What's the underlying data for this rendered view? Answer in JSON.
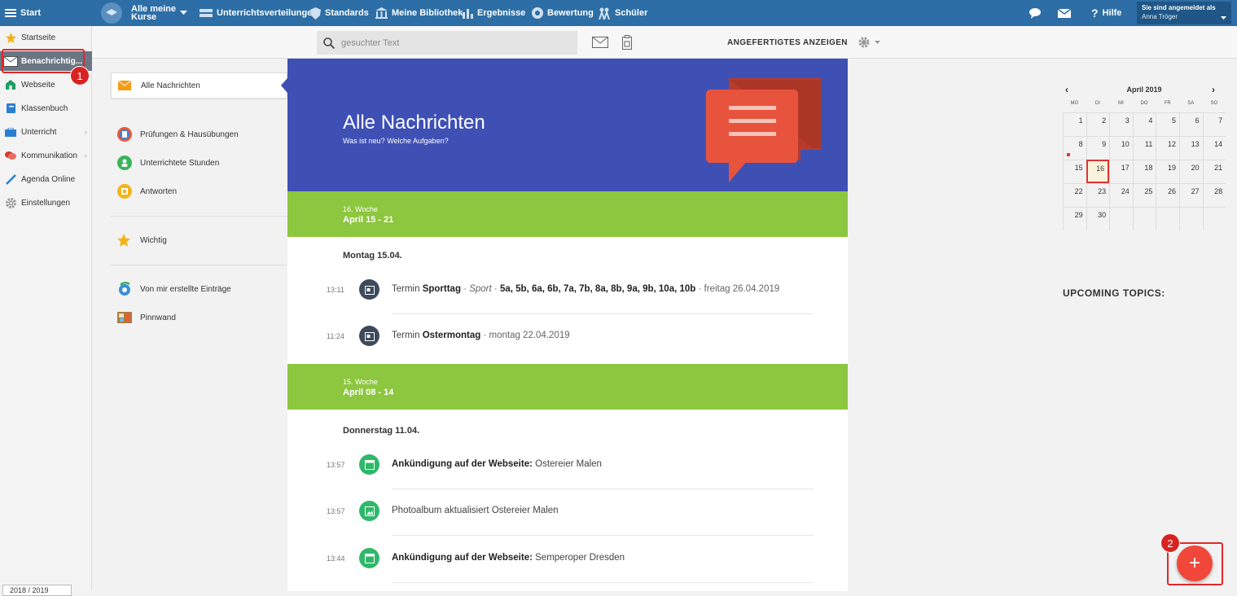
{
  "topbar": {
    "menu_label": "Start",
    "courses_label_1": "Alle meine",
    "courses_label_2": "Kurse",
    "nav": [
      "Unterrichtsverteilungen",
      "Standards",
      "Meine Bibliothek",
      "Ergebnisse",
      "Bewertung",
      "Schüler"
    ],
    "help_label": "Hilfe",
    "logged_in_label": "Sie sind angemeldet als",
    "user_name": "Anna Tröger"
  },
  "sidebar": {
    "items": [
      "Startseite",
      "Benachrichtig...",
      "Webseite",
      "Klassenbuch",
      "Unterricht",
      "Kommunikation",
      "Agenda Online",
      "Einstellungen"
    ],
    "year": "2018 / 2019"
  },
  "toolbar": {
    "search_placeholder": "gesuchter Text",
    "show_label": "ANGEFERTIGTES ANZEIGEN"
  },
  "nav_panel": {
    "items": [
      "Alle Nachrichten",
      "Prüfungen & Hausübungen",
      "Unterrichtete Stunden",
      "Antworten",
      "Wichtig",
      "Von mir erstellte Einträge",
      "Pinnwand"
    ]
  },
  "feed": {
    "title": "Alle Nachrichten",
    "subtitle": "Was ist neu? Welche Aufgaben?",
    "weeks": [
      {
        "number": "16. Woche",
        "dates": "April 15 - 21"
      },
      {
        "number": "15. Woche",
        "dates": "April 08 - 14"
      }
    ],
    "days": [
      "Montag 15.04.",
      "Donnerstag 11.04."
    ],
    "entries": [
      {
        "time": "13:11",
        "prefix": "Termin ",
        "bold": "Sporttag",
        "sep1": " · ",
        "italic": "Sport",
        "sep2": " · ",
        "classes": "5a, 5b, 6a, 6b, 7a, 7b, 8a, 8b, 9a, 9b, 10a, 10b",
        "suffix": " · freitag 26.04.2019"
      },
      {
        "time": "11:24",
        "prefix": "Termin ",
        "bold": "Ostermontag",
        "suffix": " · montag 22.04.2019"
      },
      {
        "time": "13:57",
        "bold": "Ankündigung auf der Webseite:",
        "suffix": " Ostereier Malen"
      },
      {
        "time": "13:57",
        "text": "Photoalbum aktualisiert Ostereier Malen"
      },
      {
        "time": "13:44",
        "bold": "Ankündigung auf der Webseite:",
        "suffix": " Semperoper Dresden"
      }
    ]
  },
  "calendar": {
    "month_label": "April 2019",
    "weekdays": [
      "MO",
      "DI",
      "MI",
      "DO",
      "FR",
      "SA",
      "SO"
    ],
    "weeks": [
      [
        "1",
        "2",
        "3",
        "4",
        "5",
        "6",
        "7"
      ],
      [
        "8",
        "9",
        "10",
        "11",
        "12",
        "13",
        "14"
      ],
      [
        "15",
        "16",
        "17",
        "18",
        "19",
        "20",
        "21"
      ],
      [
        "22",
        "23",
        "24",
        "25",
        "26",
        "27",
        "28"
      ],
      [
        "29",
        "30",
        "",
        "",
        "",
        "",
        ""
      ]
    ],
    "today": "16",
    "prev": "‹",
    "next": "›"
  },
  "upcoming_label": "UPCOMING TOPICS:",
  "fab_label": "+",
  "annotations": [
    "1",
    "2"
  ],
  "colors": {
    "topbar": "#2d6ea6",
    "hero": "#3f50b5",
    "week_band": "#8dc63f",
    "fab": "#f0473a",
    "callout": "#e02828"
  }
}
